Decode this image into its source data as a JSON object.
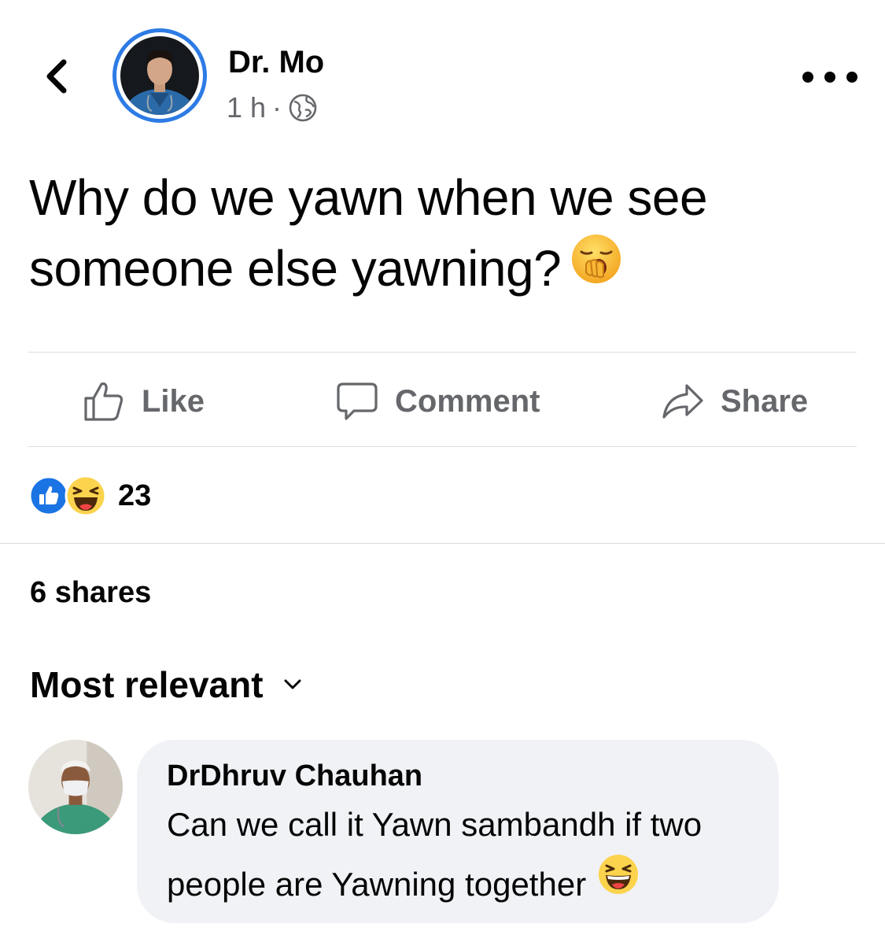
{
  "header": {
    "author_name": "Dr. Mo",
    "time": "1 h",
    "separator": "·",
    "privacy_icon": "globe-icon"
  },
  "post": {
    "text": "Why do we yawn when we see someone else yawning?",
    "emoji": "yawning-face"
  },
  "actions": {
    "like_label": "Like",
    "comment_label": "Comment",
    "share_label": "Share"
  },
  "reactions": {
    "icons": [
      "like-reaction-icon",
      "haha-reaction-icon"
    ],
    "count": "23"
  },
  "shares_text": "6 shares",
  "sort_label": "Most relevant",
  "comments": [
    {
      "author": "DrDhruv Chauhan",
      "text": "Can we call it Yawn sambandh if two people are Yawning together",
      "emoji": "grinning-squinting-face"
    }
  ],
  "colors": {
    "accent": "#2d7be5",
    "muted_text": "#65676b",
    "bubble_bg": "#f0f2f5",
    "divider": "#dadde1",
    "like_blue": "#1b74e4"
  }
}
